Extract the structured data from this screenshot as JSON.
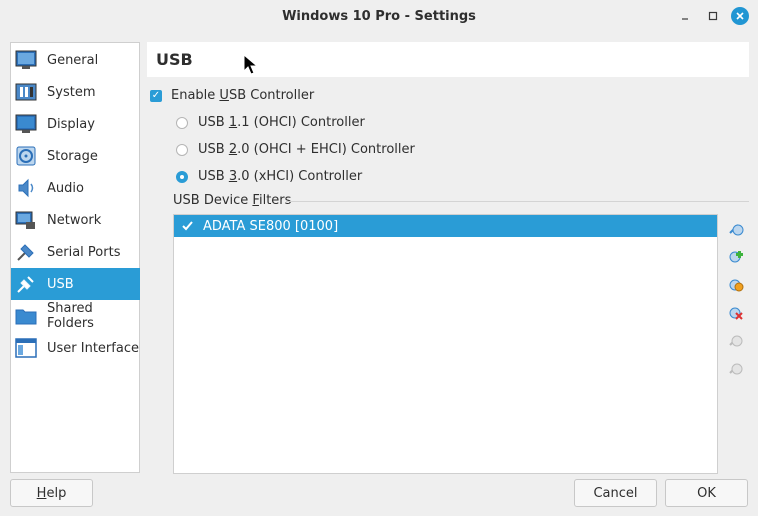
{
  "window": {
    "title": "Windows 10 Pro - Settings"
  },
  "sidebar": {
    "items": [
      {
        "label": "General",
        "icon": "general-icon"
      },
      {
        "label": "System",
        "icon": "system-icon"
      },
      {
        "label": "Display",
        "icon": "display-icon"
      },
      {
        "label": "Storage",
        "icon": "storage-icon"
      },
      {
        "label": "Audio",
        "icon": "audio-icon"
      },
      {
        "label": "Network",
        "icon": "network-icon"
      },
      {
        "label": "Serial Ports",
        "icon": "serial-ports-icon"
      },
      {
        "label": "USB",
        "icon": "usb-icon",
        "selected": true
      },
      {
        "label": "Shared Folders",
        "icon": "shared-folders-icon"
      },
      {
        "label": "User Interface",
        "icon": "user-interface-icon"
      }
    ]
  },
  "page": {
    "title": "USB",
    "enable_usb": {
      "label_pre": "Enable ",
      "label_u": "U",
      "label_post": "SB Controller",
      "checked": true
    },
    "controllers": [
      {
        "pre": "USB ",
        "u": "1",
        "post": ".1 (OHCI) Controller",
        "selected": false
      },
      {
        "pre": "USB ",
        "u": "2",
        "post": ".0 (OHCI + EHCI) Controller",
        "selected": false
      },
      {
        "pre": "USB ",
        "u": "3",
        "post": ".0 (xHCI) Controller",
        "selected": true
      }
    ],
    "filters": {
      "heading_pre": "USB Device ",
      "heading_u": "F",
      "heading_post": "ilters",
      "items": [
        {
          "label": "ADATA SE800 [0100]",
          "checked": true
        }
      ],
      "toolbar": [
        "add-empty-filter-icon",
        "add-filter-from-device-icon",
        "edit-filter-icon",
        "remove-filter-icon",
        "move-up-icon",
        "move-down-icon"
      ]
    }
  },
  "buttons": {
    "help_u": "H",
    "help_rest": "elp",
    "cancel": "Cancel",
    "ok": "OK"
  },
  "colors": {
    "accent": "#2a9cd6",
    "close": "#2196d3"
  }
}
